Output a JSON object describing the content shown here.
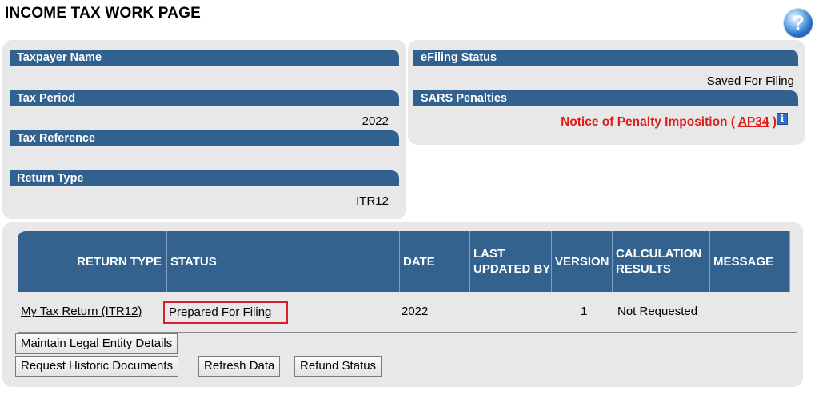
{
  "page": {
    "title": "INCOME TAX WORK PAGE",
    "help_icon_glyph": "?"
  },
  "taxpayer": {
    "name_label": "Taxpayer Name",
    "period_label": "Tax Period",
    "period_value": "2022",
    "reference_label": "Tax Reference",
    "return_type_label": "Return Type",
    "return_type_value": "ITR12"
  },
  "efiling": {
    "status_label": "eFiling Status",
    "status_value": "Saved For Filing",
    "penalties_label": "SARS Penalties",
    "penalty_text_prefix": "Notice of Penalty Imposition (",
    "penalty_link": "AP34",
    "penalty_text_suffix": ")",
    "info_icon_glyph": "i"
  },
  "table": {
    "headers": {
      "return_type": "RETURN TYPE",
      "status": "STATUS",
      "date": "DATE",
      "last_updated": "LAST UPDATED BY",
      "version": "VERSION",
      "calculation": "CALCULATION RESULTS",
      "message": "MESSAGE"
    },
    "rows": [
      {
        "return_type": "My Tax Return (ITR12)",
        "status": "Prepared For Filing",
        "date": "2022",
        "last_updated": "",
        "version": "1",
        "calculation": "Not Requested",
        "message": ""
      }
    ]
  },
  "buttons": {
    "maintain_entity": "Maintain Legal Entity Details",
    "historic_docs": "Request Historic Documents",
    "refresh": "Refresh Data",
    "refund": "Refund Status"
  },
  "colors": {
    "header_blue": "#31618f",
    "penalty_red": "#e21b1b",
    "status_border": "#d81f2a"
  }
}
